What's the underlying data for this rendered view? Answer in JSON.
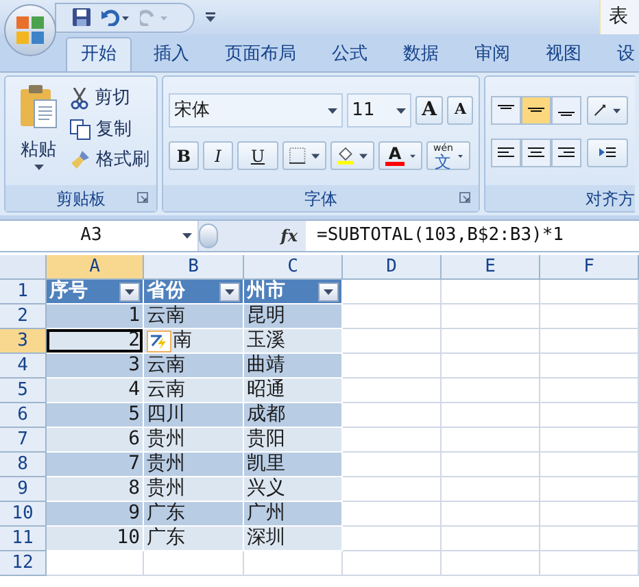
{
  "window": {
    "title": "表"
  },
  "tabs": [
    {
      "label": "开始",
      "selected": true
    },
    {
      "label": "插入",
      "selected": false
    },
    {
      "label": "页面布局",
      "selected": false
    },
    {
      "label": "公式",
      "selected": false
    },
    {
      "label": "数据",
      "selected": false
    },
    {
      "label": "审阅",
      "selected": false
    },
    {
      "label": "视图",
      "selected": false
    },
    {
      "label": "设",
      "selected": false
    }
  ],
  "clipboard": {
    "paste": "粘贴",
    "cut": "剪切",
    "copy": "复制",
    "format_painter": "格式刷",
    "label": "剪贴板"
  },
  "font": {
    "name": "宋体",
    "size": "11",
    "grow": "A",
    "shrink": "A",
    "bold": "B",
    "italic": "I",
    "underline": "U",
    "font_color": "A",
    "phonetic_top": "wén",
    "phonetic_main": "文",
    "label": "字体"
  },
  "alignment": {
    "vertical": [
      {
        "selected": false
      },
      {
        "selected": true
      },
      {
        "selected": false
      }
    ],
    "label": "对齐方"
  },
  "formula_bar": {
    "name_box": "A3",
    "fx": "fx",
    "formula": "=SUBTOTAL(103,B$2:B3)*1"
  },
  "sheet": {
    "columns": [
      {
        "label": "A",
        "selected": true
      },
      {
        "label": "B",
        "selected": false
      },
      {
        "label": "C",
        "selected": false
      },
      {
        "label": "D",
        "selected": false
      },
      {
        "label": "E",
        "selected": false
      },
      {
        "label": "F",
        "selected": false
      }
    ],
    "header": [
      "序号",
      "省份",
      "州市"
    ],
    "rows": [
      {
        "number": "1",
        "selected": false,
        "cells": []
      },
      {
        "number": "2",
        "selected": false,
        "cells": [
          "1",
          "云南",
          "昆明"
        ]
      },
      {
        "number": "3",
        "selected": true,
        "cells": [
          "2",
          "南",
          "玉溪"
        ]
      },
      {
        "number": "4",
        "selected": false,
        "cells": [
          "3",
          "云南",
          "曲靖"
        ]
      },
      {
        "number": "5",
        "selected": false,
        "cells": [
          "4",
          "云南",
          "昭通"
        ]
      },
      {
        "number": "6",
        "selected": false,
        "cells": [
          "5",
          "四川",
          "成都"
        ]
      },
      {
        "number": "7",
        "selected": false,
        "cells": [
          "6",
          "贵州",
          "贵阳"
        ]
      },
      {
        "number": "8",
        "selected": false,
        "cells": [
          "7",
          "贵州",
          "凯里"
        ]
      },
      {
        "number": "9",
        "selected": false,
        "cells": [
          "8",
          "贵州",
          "兴义"
        ]
      },
      {
        "number": "10",
        "selected": false,
        "cells": [
          "9",
          "广东",
          "广州"
        ]
      },
      {
        "number": "11",
        "selected": false,
        "cells": [
          "10",
          "广东",
          "深圳"
        ]
      },
      {
        "number": "12",
        "selected": false,
        "cells": []
      }
    ]
  }
}
